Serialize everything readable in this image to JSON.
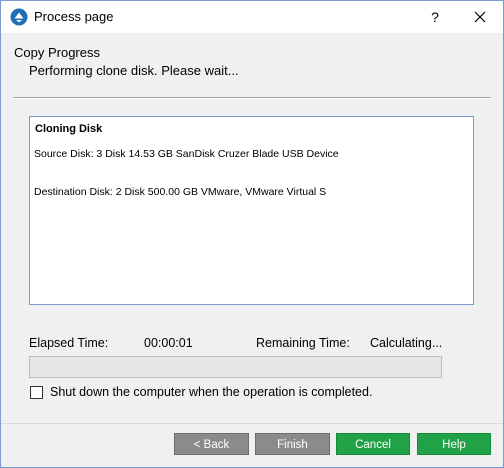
{
  "window": {
    "title": "Process page",
    "help_glyph": "?",
    "close_icon": "close-icon",
    "app_icon": "minitool-app-icon"
  },
  "header": {
    "heading": "Copy Progress",
    "status": "Performing clone disk. Please wait..."
  },
  "info": {
    "title": "Cloning Disk",
    "source": "Source Disk: 3 Disk 14.53 GB SanDisk Cruzer Blade USB Device",
    "destination": "Destination Disk: 2 Disk 500.00 GB VMware, VMware Virtual S"
  },
  "timing": {
    "elapsed_label": "Elapsed Time:",
    "elapsed_value": "00:00:01",
    "remaining_label": "Remaining Time:",
    "remaining_value": "Calculating..."
  },
  "progress": {
    "percent": 0
  },
  "shutdown_option": {
    "label": "Shut down the computer when the operation is completed.",
    "checked": false
  },
  "buttons": {
    "back": "< Back",
    "finish": "Finish",
    "cancel": "Cancel",
    "help": "Help"
  },
  "colors": {
    "primary_button": "#21a247",
    "disabled_button": "#8b8b8b",
    "box_border": "#7a9ccf"
  }
}
